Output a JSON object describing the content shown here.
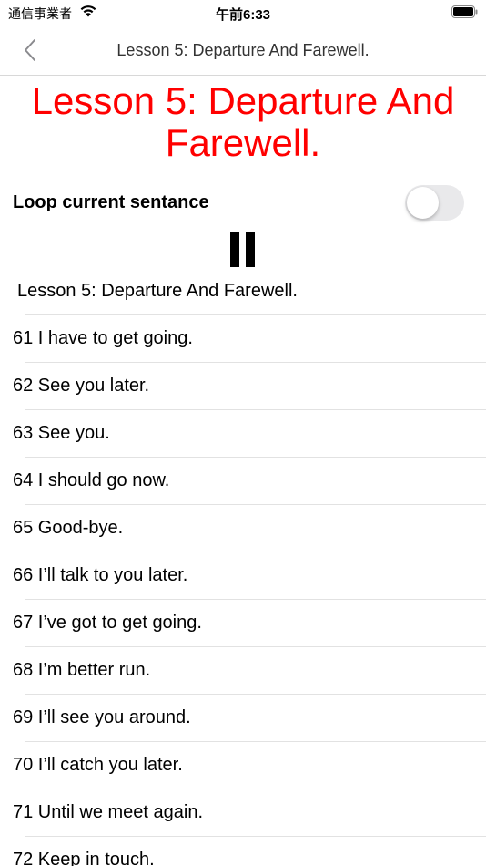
{
  "status_bar": {
    "carrier": "通信事業者",
    "time": "午前6:33",
    "wifi_icon": "wifi-icon",
    "battery_icon": "battery-icon"
  },
  "nav": {
    "back_icon": "chevron-left-icon",
    "title": "Lesson 5: Departure And Farewell."
  },
  "lesson": {
    "heading": "Lesson 5: Departure And Farewell.",
    "heading_color": "#ff0000"
  },
  "loop": {
    "label": "Loop current sentance",
    "enabled": false
  },
  "player": {
    "state_icon": "pause-icon"
  },
  "sentences": [
    "Lesson 5: Departure And Farewell.",
    "61 I have to get going.",
    "62 See you later.",
    "63 See you.",
    "64 I should go now.",
    "65 Good-bye.",
    "66 I’ll talk to you later.",
    "67 I’ve got to get going.",
    "68 I’m better run.",
    "69 I’ll see you around.",
    "70 I’ll catch you later.",
    "71 Until we meet again.",
    "72 Keep in touch."
  ]
}
